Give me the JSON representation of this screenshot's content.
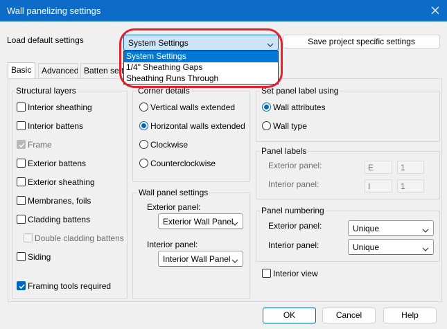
{
  "window": {
    "title": "Wall panelizing settings"
  },
  "load_defaults": {
    "label": "Load default settings",
    "selected": "System Settings",
    "options": [
      "System Settings",
      "1/4\" Sheathing Gaps",
      "Sheathing Runs Through"
    ],
    "save_button": "Save project specific settings"
  },
  "tabs": [
    {
      "label": "Basic",
      "active": true
    },
    {
      "label": "Advanced",
      "active": false
    },
    {
      "label": "Batten setti",
      "active": false
    }
  ],
  "structural_layers": {
    "title": "Structural layers",
    "items": [
      {
        "label": "Interior sheathing",
        "checked": false,
        "enabled": true
      },
      {
        "label": "Interior battens",
        "checked": false,
        "enabled": true
      },
      {
        "label": "Frame",
        "checked": true,
        "enabled": false
      },
      {
        "label": "Exterior battens",
        "checked": false,
        "enabled": true
      },
      {
        "label": "Exterior sheathing",
        "checked": false,
        "enabled": true
      },
      {
        "label": "Membranes, foils",
        "checked": false,
        "enabled": true
      },
      {
        "label": "Cladding battens",
        "checked": false,
        "enabled": true
      },
      {
        "label": "Double cladding battens",
        "checked": false,
        "enabled": false
      },
      {
        "label": "Siding",
        "checked": false,
        "enabled": true
      }
    ],
    "framing_tools": {
      "label": "Framing tools required",
      "checked": true
    }
  },
  "corner_details": {
    "title": "Corner details",
    "options": [
      {
        "label": "Vertical walls extended",
        "selected": false
      },
      {
        "label": "Horizontal walls extended",
        "selected": true
      },
      {
        "label": "Clockwise",
        "selected": false
      },
      {
        "label": "Counterclockwise",
        "selected": false
      }
    ]
  },
  "wall_panel_settings": {
    "title": "Wall panel settings",
    "exterior_label": "Exterior panel:",
    "exterior_value": "Exterior Wall Panel",
    "interior_label": "Interior panel:",
    "interior_value": "Interior Wall Panel"
  },
  "set_panel_label": {
    "title": "Set panel label using",
    "options": [
      {
        "label": "Wall attributes",
        "selected": true
      },
      {
        "label": "Wall type",
        "selected": false
      }
    ]
  },
  "panel_labels": {
    "title": "Panel labels",
    "exterior_label": "Exterior panel:",
    "exterior_prefix": "E",
    "exterior_number": "1",
    "interior_label": "Interior panel:",
    "interior_prefix": "I",
    "interior_number": "1"
  },
  "panel_numbering": {
    "title": "Panel numbering",
    "exterior_label": "Exterior panel:",
    "exterior_value": "Unique",
    "interior_label": "Interior panel:",
    "interior_value": "Unique"
  },
  "interior_view": {
    "label": "Interior view",
    "checked": false
  },
  "footer": {
    "ok": "OK",
    "cancel": "Cancel",
    "help": "Help"
  },
  "colors": {
    "titlebar": "#0c6cc8",
    "accent": "#0067c0",
    "selection": "#0078d7",
    "highlight": "#e8212e"
  }
}
